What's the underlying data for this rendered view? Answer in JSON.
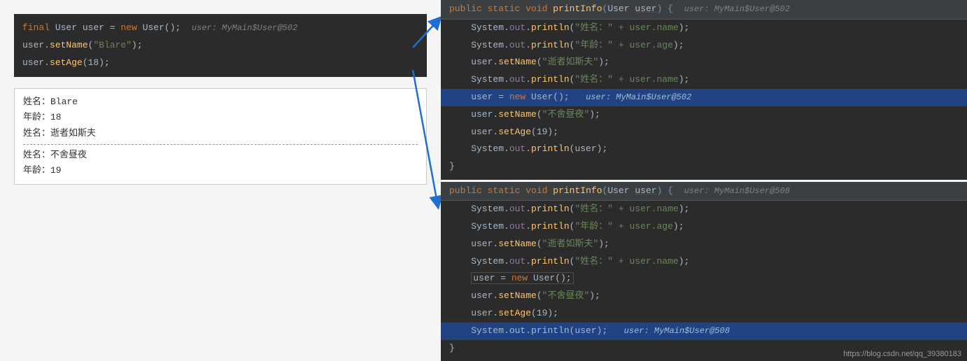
{
  "left": {
    "code_lines": [
      {
        "text": "final User user = new User();",
        "suffix": "   user: MyMain$User@502",
        "highlight": false
      },
      {
        "text": "user.setName(\"Blare\");",
        "suffix": "",
        "highlight": false
      },
      {
        "text": "user.setAge(18);",
        "suffix": "",
        "highlight": false
      }
    ],
    "output_lines": [
      "姓名：Blare",
      "年龄：18",
      "姓名：逝者如斯夫",
      "---divider---",
      "姓名：不舍昼夜",
      "年龄：19"
    ]
  },
  "right_top": {
    "header": "public static void printInfo(User user) {",
    "header_suffix": "  user: MyMain$User@502",
    "lines": [
      {
        "text": "    System.out.println(\"姓名：\" + user.name);",
        "highlight": false
      },
      {
        "text": "    System.out.println(\"年龄：\" + user.age);",
        "highlight": false
      },
      {
        "text": "    user.setName(\"逝者如斯夫\");",
        "highlight": false
      },
      {
        "text": "    System.out.println(\"姓名：\" + user.name);",
        "highlight": false
      },
      {
        "text": "    user = new User();   user: MyMain$User@502",
        "highlight": true
      },
      {
        "text": "    user.setName(\"不舍昼夜\");",
        "highlight": false
      },
      {
        "text": "    user.setAge(19);",
        "highlight": false
      },
      {
        "text": "    System.out.println(user);",
        "highlight": false
      },
      {
        "text": "}",
        "highlight": false
      }
    ]
  },
  "right_bottom": {
    "header": "public static void printInfo(User user) {",
    "header_suffix": "  user: MyMain$User@508",
    "lines": [
      {
        "text": "    System.out.println(\"姓名：\" + user.name);",
        "highlight": false
      },
      {
        "text": "    System.out.println(\"年龄：\" + user.age);",
        "highlight": false
      },
      {
        "text": "    user.setName(\"逝者如斯夫\");",
        "highlight": false
      },
      {
        "text": "    System.out.println(\"姓名：\" + user.name);",
        "highlight": false
      },
      {
        "text": "    user = new User();",
        "highlight": false,
        "redbox": true
      },
      {
        "text": "    user.setName(\"不舍昼夜\");",
        "highlight": false
      },
      {
        "text": "    user.setAge(19);",
        "highlight": false
      },
      {
        "text": "    System.out.println(user);   user: MyMain$User@508",
        "highlight": true
      },
      {
        "text": "}",
        "highlight": false
      }
    ]
  },
  "watermark": "https://blog.csdn.net/qq_39380183"
}
